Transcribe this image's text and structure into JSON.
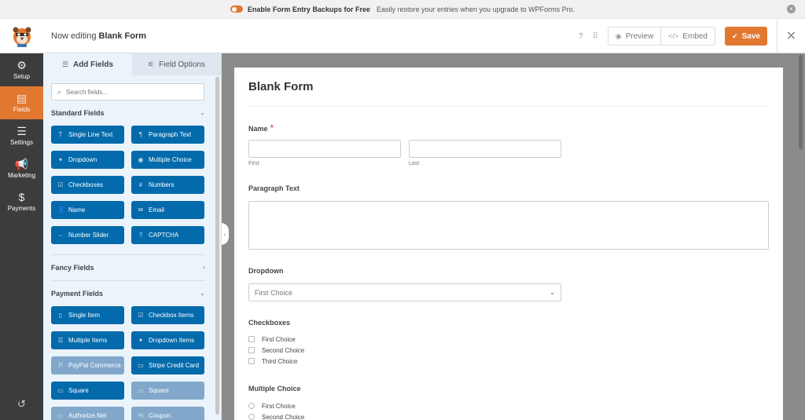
{
  "notice": {
    "title": "Enable Form Entry Backups for Free",
    "message": "Easily restore your entries when you upgrade to WPForms Pro.",
    "close_glyph": "×"
  },
  "header": {
    "editing_prefix": "Now editing",
    "form_name": "Blank Form",
    "preview_label": "Preview",
    "embed_label": "Embed",
    "save_label": "Save"
  },
  "nav": {
    "items": [
      {
        "label": "Setup",
        "icon": "gear-icon",
        "glyph": "⚙"
      },
      {
        "label": "Fields",
        "icon": "fields-icon",
        "glyph": "▤"
      },
      {
        "label": "Settings",
        "icon": "sliders-icon",
        "glyph": "☰"
      },
      {
        "label": "Marketing",
        "icon": "megaphone-icon",
        "glyph": "📢"
      },
      {
        "label": "Payments",
        "icon": "dollar-icon",
        "glyph": "$"
      }
    ]
  },
  "panel": {
    "tabs": {
      "add_fields": "Add Fields",
      "field_options": "Field Options"
    },
    "search_placeholder": "Search fields...",
    "sections": {
      "standard": "Standard Fields",
      "fancy": "Fancy Fields",
      "payment": "Payment Fields"
    },
    "standard_fields": [
      {
        "label": "Single Line Text",
        "glyph": "T"
      },
      {
        "label": "Paragraph Text",
        "glyph": "¶"
      },
      {
        "label": "Dropdown",
        "glyph": "▾"
      },
      {
        "label": "Multiple Choice",
        "glyph": "◉"
      },
      {
        "label": "Checkboxes",
        "glyph": "☑"
      },
      {
        "label": "Numbers",
        "glyph": "#"
      },
      {
        "label": "Name",
        "glyph": "👤"
      },
      {
        "label": "Email",
        "glyph": "✉"
      },
      {
        "label": "Number Slider",
        "glyph": "⇔"
      },
      {
        "label": "CAPTCHA",
        "glyph": "?"
      }
    ],
    "payment_fields": [
      {
        "label": "Single Item",
        "glyph": "▯"
      },
      {
        "label": "Checkbox Items",
        "glyph": "☑"
      },
      {
        "label": "Multiple Items",
        "glyph": "☰"
      },
      {
        "label": "Dropdown Items",
        "glyph": "▾"
      },
      {
        "label": "PayPal Commerce",
        "glyph": "P"
      },
      {
        "label": "Stripe Credit Card",
        "glyph": "▭"
      },
      {
        "label": "Square",
        "glyph": "▭"
      },
      {
        "label": "Square",
        "glyph": "▭"
      },
      {
        "label": "Authorize.Net",
        "glyph": "▭"
      },
      {
        "label": "Coupon",
        "glyph": "%"
      }
    ]
  },
  "form": {
    "title": "Blank Form",
    "name_label": "Name",
    "name_required": "*",
    "first_sub": "First",
    "last_sub": "Last",
    "paragraph_label": "Paragraph Text",
    "dropdown_label": "Dropdown",
    "dropdown_value": "First Choice",
    "checkboxes_label": "Checkboxes",
    "checkbox_choices": [
      "First Choice",
      "Second Choice",
      "Third Choice"
    ],
    "multiple_label": "Multiple Choice",
    "multiple_choices": [
      "First Choice",
      "Second Choice"
    ]
  },
  "colors": {
    "accent": "#e27730",
    "field_button": "#036aab",
    "nav_bg": "#3c3c3c",
    "panel_bg": "#ebf3fb"
  }
}
